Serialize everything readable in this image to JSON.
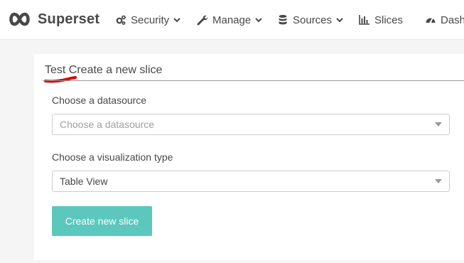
{
  "navbar": {
    "brand": {
      "name": "Superset",
      "logo_icon": "infinity-logo-icon"
    },
    "items": [
      {
        "label": "Security",
        "icon": "gears-icon",
        "has_dropdown": true
      },
      {
        "label": "Manage",
        "icon": "wrench-icon",
        "has_dropdown": true
      },
      {
        "label": "Sources",
        "icon": "database-icon",
        "has_dropdown": true
      },
      {
        "label": "Slices",
        "icon": "bar-chart-icon",
        "has_dropdown": false
      },
      {
        "label": "Dash",
        "icon": "dashboard-icon",
        "has_dropdown": false
      }
    ]
  },
  "panel": {
    "title": "Test Create a new slice",
    "annotation_color": "#e00000",
    "datasource": {
      "label": "Choose a datasource",
      "placeholder": "Choose a datasource",
      "value": ""
    },
    "viz_type": {
      "label": "Choose a visualization type",
      "value": "Table View"
    },
    "submit_label": "Create new slice"
  },
  "colors": {
    "button": "#5bc7bd",
    "text": "#484848",
    "background": "#f5f5f5"
  }
}
